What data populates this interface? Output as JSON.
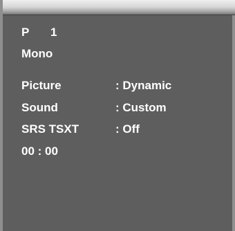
{
  "osd": {
    "program_label": "P",
    "program_number": "1",
    "audio_mode": "Mono",
    "settings": [
      {
        "label": "Picture",
        "value": ": Dynamic"
      },
      {
        "label": "Sound",
        "value": ": Custom"
      },
      {
        "label": "SRS TSXT",
        "value": ": Off"
      }
    ],
    "clock": "00 : 00"
  }
}
